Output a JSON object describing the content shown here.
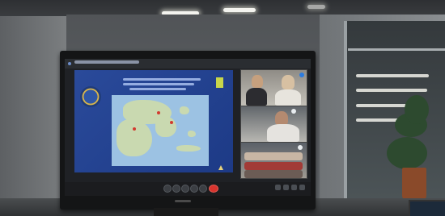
{
  "scene": {
    "description_type": "photo of a TV screen showing a video call"
  },
  "colors": {
    "slide_bg": "#1d3a86",
    "end_call": "#d8342e",
    "accent_dot": "#2b7be0"
  },
  "icons": [
    "seal-icon",
    "map-pin-icon",
    "mic-icon",
    "camera-icon",
    "end-call-icon",
    "cursor-icon"
  ]
}
